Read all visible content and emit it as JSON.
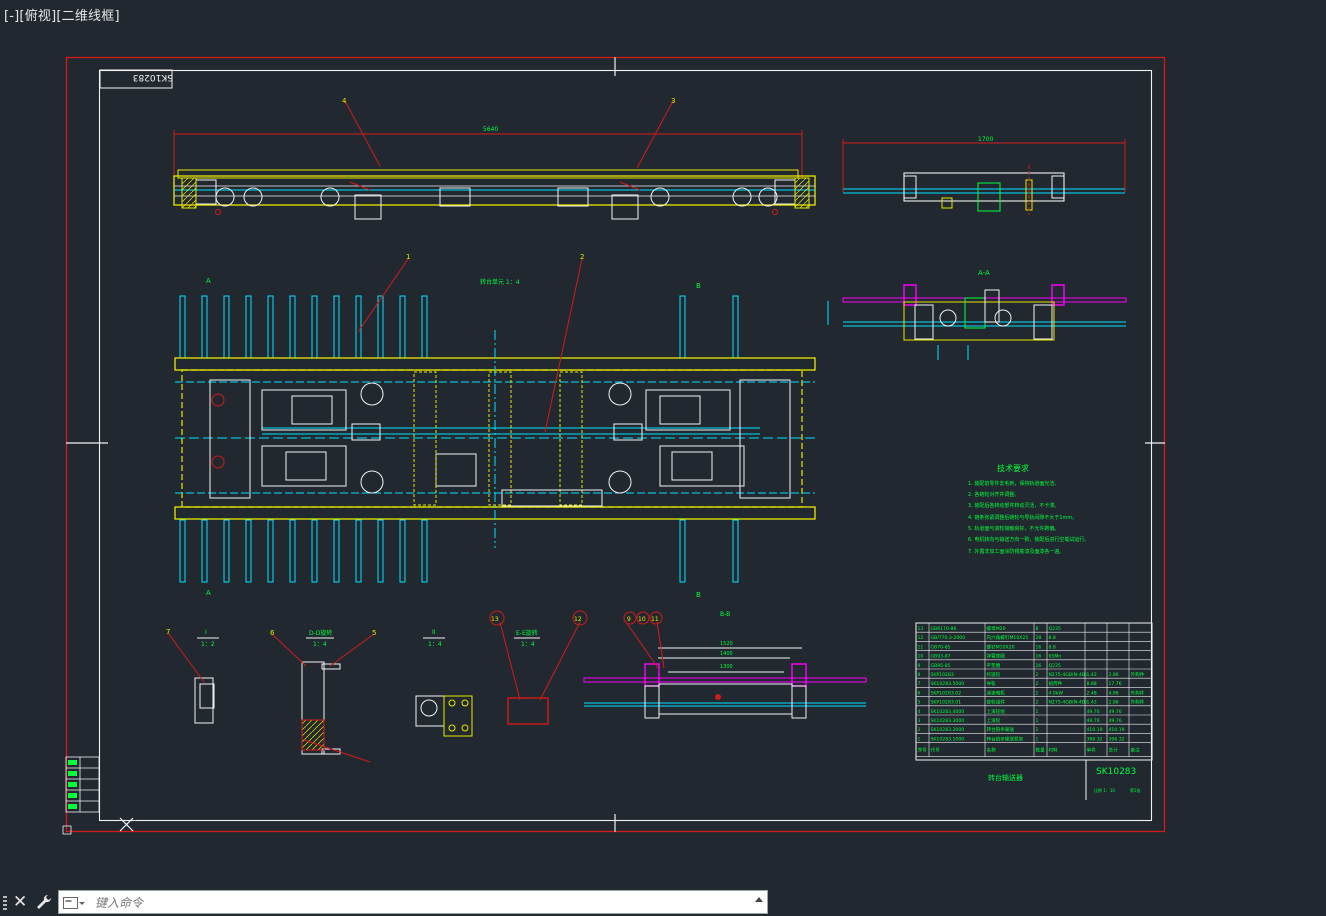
{
  "viewport": {
    "label": "[-][俯视][二维线框]"
  },
  "drawing": {
    "stamp_mirrored": "SK10283",
    "views": {
      "a_a": "A-A",
      "b_b": "B-B",
      "section_a_top": "A",
      "section_a_bottom": "A",
      "section_b_top": "B",
      "section_b_bottom": "B",
      "plan_note": "转台单元 1：4"
    },
    "details": [
      {
        "label": "I",
        "scale": "1：2"
      },
      {
        "label": "D-D旋转",
        "scale": "1：4"
      },
      {
        "label": "II",
        "scale": "1：4"
      },
      {
        "label": "E-E旋转",
        "scale": "1：4"
      }
    ],
    "balloons_top": [
      "4",
      "3"
    ],
    "balloons_plan": [
      "1",
      "2"
    ],
    "balloons_detail": [
      "7",
      "6",
      "5",
      "13",
      "12",
      "9",
      "10",
      "11"
    ],
    "dims": {
      "top_len": "5640",
      "side_len": "1700",
      "bb_1": "1520",
      "bb_2": "1400",
      "bb_3": "1300"
    },
    "tech_title": "技术要求",
    "tech_notes": [
      "1. 装配前零件去毛刺，保持轨道面光洁。",
      "2. 各链轮对齐并调整。",
      "3. 装配后各转动部件转动灵活，不卡滞。",
      "4. 链条张紧调整后链轮与导轨间隙不大于1mm。",
      "5. 轨道面与滚轮接触良好，不允许跑偏。",
      "6. 电机转向与输送方向一致，装配后进行空载试运行。",
      "7. 外露非加工面涂防锈底漆及面漆各一遍。"
    ],
    "bom_header": [
      "序号",
      "代号",
      "名称",
      "数量",
      "材料",
      "单件",
      "总计",
      "备注"
    ],
    "bom_rows": [
      [
        "13",
        "GB6170-86",
        "螺母M20",
        "8",
        "Q235",
        "",
        "",
        ""
      ],
      [
        "12",
        "GB/T70.3-2000",
        "内六角螺钉M10X25",
        "28",
        "8.8",
        "",
        "",
        ""
      ],
      [
        "11",
        "GB70-85",
        "螺钉M10X20",
        "16",
        "8.8",
        "",
        "",
        ""
      ],
      [
        "10",
        "GB93-87",
        "弹簧垫圈",
        "16",
        "65Mn",
        "",
        "",
        ""
      ],
      [
        "9",
        "GB95-85",
        "平垫圈",
        "16",
        "Q235",
        "",
        "",
        ""
      ],
      [
        "8",
        "SKP10283",
        "托链轮",
        "2",
        "N275-4GB(N-4B)",
        "1.43",
        "2.86",
        "外购件"
      ],
      [
        "7",
        "SK10283.5000",
        "导轨",
        "2",
        "组焊件",
        "8.88",
        "17.76",
        ""
      ],
      [
        "6",
        "SKP10283.02",
        "减速电机",
        "2",
        "4.0kW",
        "2.48",
        "4.96",
        "外购件"
      ],
      [
        "5",
        "SKP10283.01",
        "链轮组件",
        "2",
        "N275-4GB(N-4B)",
        "1.43",
        "2.86",
        "外购件"
      ],
      [
        "4",
        "SK10283.4000",
        "上滚轮组",
        "1",
        "",
        "49.76",
        "49.76",
        ""
      ],
      [
        "3",
        "SK10283.3000",
        "上滚轮",
        "1",
        "",
        "49.76",
        "49.76",
        ""
      ],
      [
        "2",
        "SK10283.2000",
        "转台链条输送",
        "1",
        "",
        "410.19",
        "410.19",
        ""
      ],
      [
        "1",
        "SK10283.1000",
        "转台链条输送机架",
        "1",
        "",
        "396.32",
        "396.32",
        ""
      ]
    ],
    "title_name": "转台输送器",
    "title_code": "SK10283",
    "title_sub": "比例 1：10",
    "title_sheet": "第1张"
  },
  "command": {
    "placeholder": "键入命令"
  },
  "colors": {
    "background": "#212830",
    "frame_red": "#d21b1b",
    "white": "#f2f2f2",
    "yellow": "#e8e800",
    "cyan": "#00e4ff",
    "green": "#00ff3c",
    "magenta": "#ff00ff"
  }
}
